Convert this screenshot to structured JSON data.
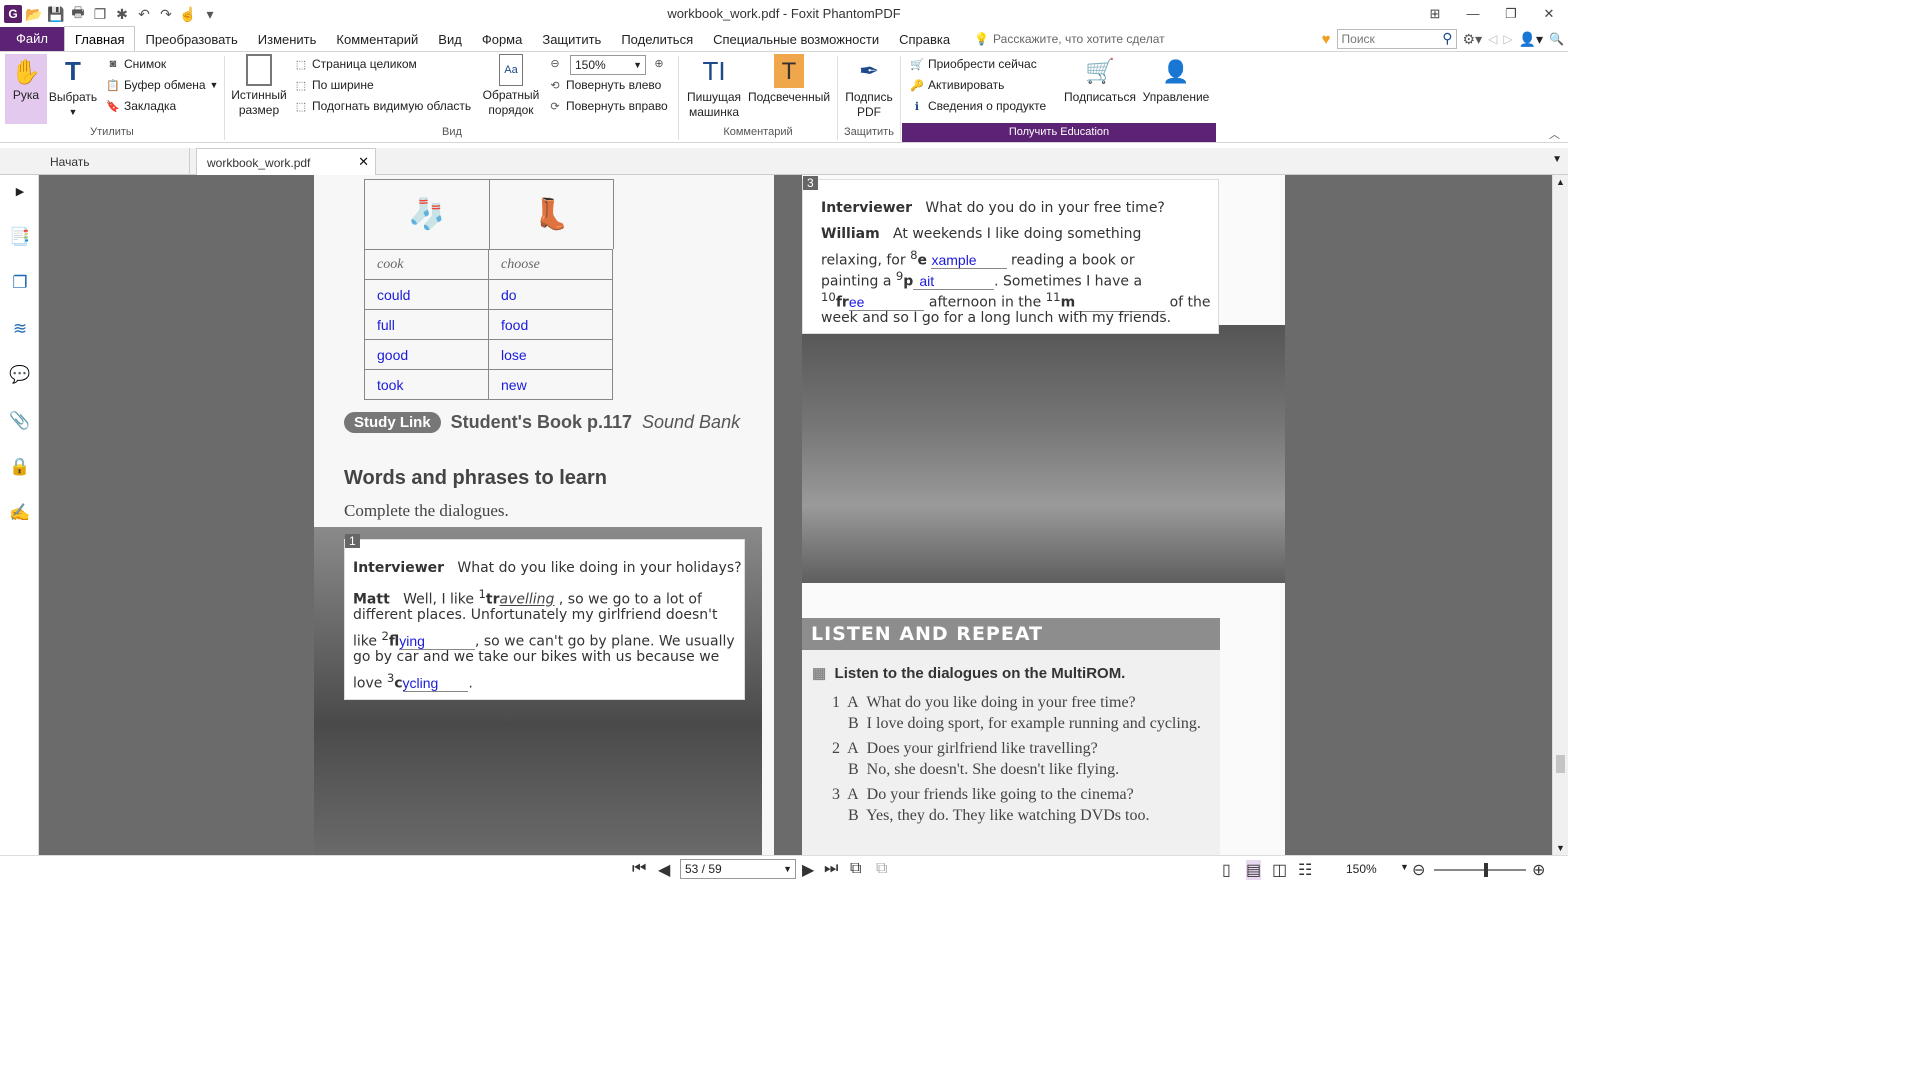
{
  "window": {
    "title": "workbook_work.pdf - Foxit PhantomPDF"
  },
  "menu": {
    "file": "Файл",
    "tabs": [
      "Главная",
      "Преобразовать",
      "Изменить",
      "Комментарий",
      "Вид",
      "Форма",
      "Защитить",
      "Поделиться",
      "Специальные возможности",
      "Справка"
    ],
    "tell_me": "Расскажите, что хотите сделат",
    "search_placeholder": "Поиск"
  },
  "ribbon": {
    "hand": "Рука",
    "select": "Выбрать",
    "snapshot": "Снимок",
    "clipboard": "Буфер обмена",
    "bookmark": "Закладка",
    "utilities_label": "Утилиты",
    "actual_size": "Истинный размер",
    "fit_page": "Страница целиком",
    "fit_width": "По ширине",
    "fit_visible": "Подогнать видимую область",
    "reverse_order": "Обратный порядок",
    "zoom": "150%",
    "rotate_left": "Повернуть влево",
    "rotate_right": "Повернуть вправо",
    "view_label": "Вид",
    "typewriter": "Пишущая машинка",
    "highlight": "Подсвеченный",
    "comment_label": "Комментарий",
    "sign_pdf": "Подпись PDF",
    "protect_label": "Защитить",
    "buy_now": "Приобрести сейчас",
    "activate": "Активировать",
    "product_info": "Сведения о продукте",
    "subscribe": "Подписаться",
    "manage": "Управление",
    "get_education": "Получить Education"
  },
  "doc_tabs": {
    "start": "Начать",
    "file": "workbook_work.pdf"
  },
  "status": {
    "page": "53 / 59",
    "zoom": "150%"
  },
  "page_left": {
    "table_headers": [
      "cook",
      "choose"
    ],
    "col1": [
      "could",
      "full",
      "good",
      "took"
    ],
    "col2": [
      "do",
      "food",
      "lose",
      "new"
    ],
    "study_link": "Study Link",
    "study_ref": "Student's Book p.117",
    "sound_bank": "Sound Bank",
    "heading": "Words and phrases to learn",
    "instruction": "Complete the dialogues.",
    "ex_num": "1",
    "interviewer": "Interviewer",
    "q1": "What do you like doing in your holidays?",
    "matt": "Matt",
    "line1a": "Well, I like",
    "blank1_prefix": "tr",
    "blank1": "avelling",
    "line1b": ", so we go to a lot of",
    "line2": "different places. Unfortunately my girlfriend doesn't",
    "line3a": "like",
    "blank2_prefix": "fl",
    "blank2": "ying",
    "line3b": ", so we can't go by plane. We usually",
    "line4": "go by car and we take our bikes with us because we",
    "line5a": "love",
    "blank3_prefix": "c",
    "blank3": "ycling",
    "line5b": "."
  },
  "page_right": {
    "ex_num": "3",
    "interviewer": "Interviewer",
    "q": "What do you do in your free time?",
    "william": "William",
    "w1": "At weekends I like doing something",
    "w2a": "relaxing, for",
    "b8_prefix": "e",
    "b8": "xample",
    "w2b": "reading a book or",
    "w3a": "painting a",
    "b9_prefix": "p",
    "b9": "ait",
    "w3b": ". Sometimes I have a",
    "b10_prefix": "fr",
    "b10": "ee",
    "w4a": "afternoon in the",
    "b11_prefix": "m",
    "w4b": "of the",
    "w5": "week and so I go for a long lunch with my friends.",
    "listen_title": "LISTEN AND REPEAT",
    "listen_instr": "Listen to the dialogues on the MultiROM.",
    "d1a": "What do you like doing in your free time?",
    "d1b": "I love doing sport, for example running and cycling.",
    "d2a": "Does your girlfriend like travelling?",
    "d2b": "No, she doesn't. She doesn't like flying.",
    "d3a": "Do your friends like going to the cinema?",
    "d3b": "Yes, they do. They like watching DVDs too."
  }
}
